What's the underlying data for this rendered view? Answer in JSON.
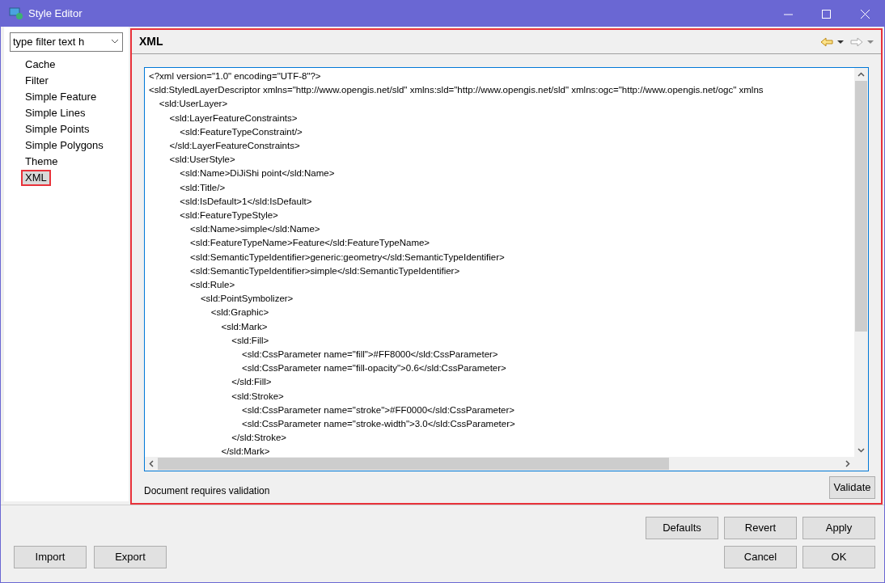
{
  "window": {
    "title": "Style Editor"
  },
  "filter": {
    "placeholder": "type filter text h"
  },
  "sidebar": {
    "items": [
      {
        "label": "Cache",
        "selected": false
      },
      {
        "label": "Filter",
        "selected": false
      },
      {
        "label": "Simple Feature",
        "selected": false
      },
      {
        "label": "Simple Lines",
        "selected": false
      },
      {
        "label": "Simple Points",
        "selected": false
      },
      {
        "label": "Simple Polygons",
        "selected": false
      },
      {
        "label": "Theme",
        "selected": false
      },
      {
        "label": "XML",
        "selected": true
      }
    ]
  },
  "page": {
    "title": "XML",
    "back_enabled": true,
    "forward_enabled": false
  },
  "editor": {
    "lines": [
      "<?xml version=\"1.0\" encoding=\"UTF-8\"?>",
      "<sld:StyledLayerDescriptor xmlns=\"http://www.opengis.net/sld\" xmlns:sld=\"http://www.opengis.net/sld\" xmlns:ogc=\"http://www.opengis.net/ogc\" xmlns",
      "    <sld:UserLayer>",
      "        <sld:LayerFeatureConstraints>",
      "            <sld:FeatureTypeConstraint/>",
      "        </sld:LayerFeatureConstraints>",
      "        <sld:UserStyle>",
      "            <sld:Name>DiJiShi point</sld:Name>",
      "            <sld:Title/>",
      "            <sld:IsDefault>1</sld:IsDefault>",
      "            <sld:FeatureTypeStyle>",
      "                <sld:Name>simple</sld:Name>",
      "                <sld:FeatureTypeName>Feature</sld:FeatureTypeName>",
      "                <sld:SemanticTypeIdentifier>generic:geometry</sld:SemanticTypeIdentifier>",
      "                <sld:SemanticTypeIdentifier>simple</sld:SemanticTypeIdentifier>",
      "                <sld:Rule>",
      "                    <sld:PointSymbolizer>",
      "                        <sld:Graphic>",
      "                            <sld:Mark>",
      "                                <sld:Fill>",
      "                                    <sld:CssParameter name=\"fill\">#FF8000</sld:CssParameter>",
      "                                    <sld:CssParameter name=\"fill-opacity\">0.6</sld:CssParameter>",
      "                                </sld:Fill>",
      "                                <sld:Stroke>",
      "                                    <sld:CssParameter name=\"stroke\">#FF0000</sld:CssParameter>",
      "                                    <sld:CssParameter name=\"stroke-width\">3.0</sld:CssParameter>",
      "                                </sld:Stroke>",
      "                            </sld:Mark>"
    ]
  },
  "status": "Document requires validation",
  "validate_button": "Validate",
  "buttons_top": [
    "Defaults",
    "Revert",
    "Apply"
  ],
  "buttons_left": [
    "Import",
    "Export"
  ],
  "buttons_right": [
    "Cancel",
    "OK"
  ]
}
